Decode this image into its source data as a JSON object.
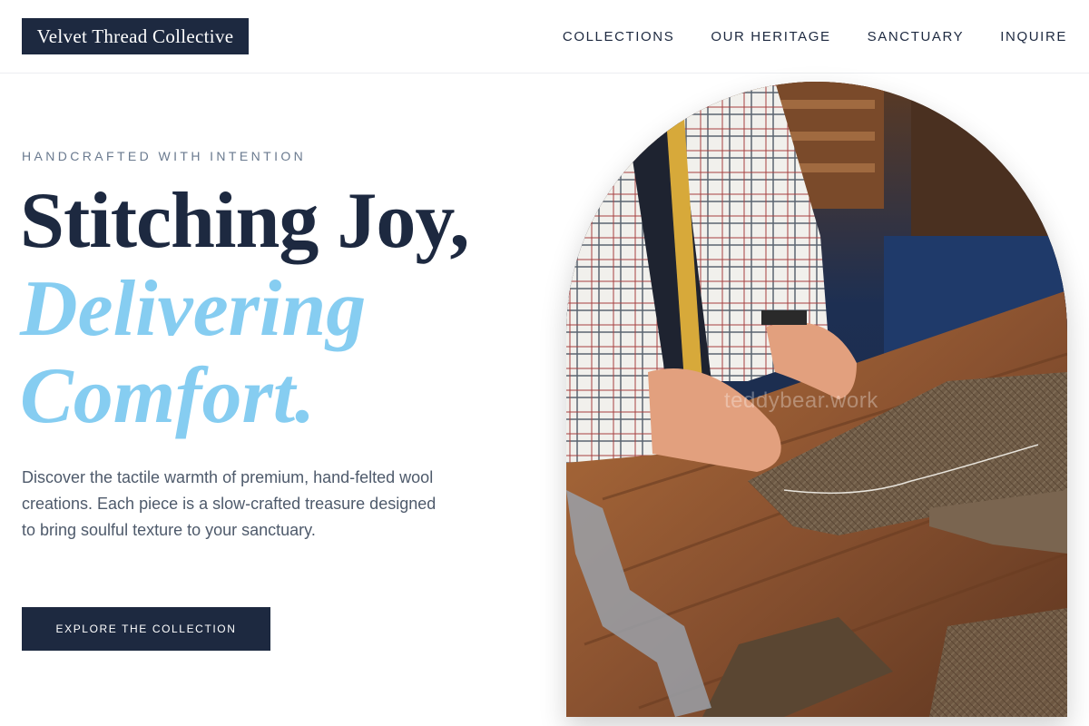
{
  "brand": {
    "name": "Velvet Thread Collective"
  },
  "nav": {
    "items": [
      {
        "label": "COLLECTIONS"
      },
      {
        "label": "OUR HERITAGE"
      },
      {
        "label": "SANCTUARY"
      },
      {
        "label": "INQUIRE"
      }
    ]
  },
  "hero": {
    "eyebrow": "HANDCRAFTED WITH INTENTION",
    "headline_line1": "Stitching Joy,",
    "headline_line2": "Delivering",
    "headline_line3": "Comfort.",
    "description": "Discover the tactile warmth of premium, hand-felted wool creations. Each piece is a slow-crafted treasure designed to bring soulful texture to your sanctuary.",
    "cta_label": "EXPLORE THE COLLECTION",
    "image_watermark": "teddybear.work"
  },
  "colors": {
    "navy": "#1d2940",
    "accent_blue": "#86cdf1",
    "eyebrow_gray": "#6a7a8f",
    "body_text": "#4e5a6b"
  },
  "icons": {
    "hero_image": "tailor-cutting-tweed-photo"
  }
}
